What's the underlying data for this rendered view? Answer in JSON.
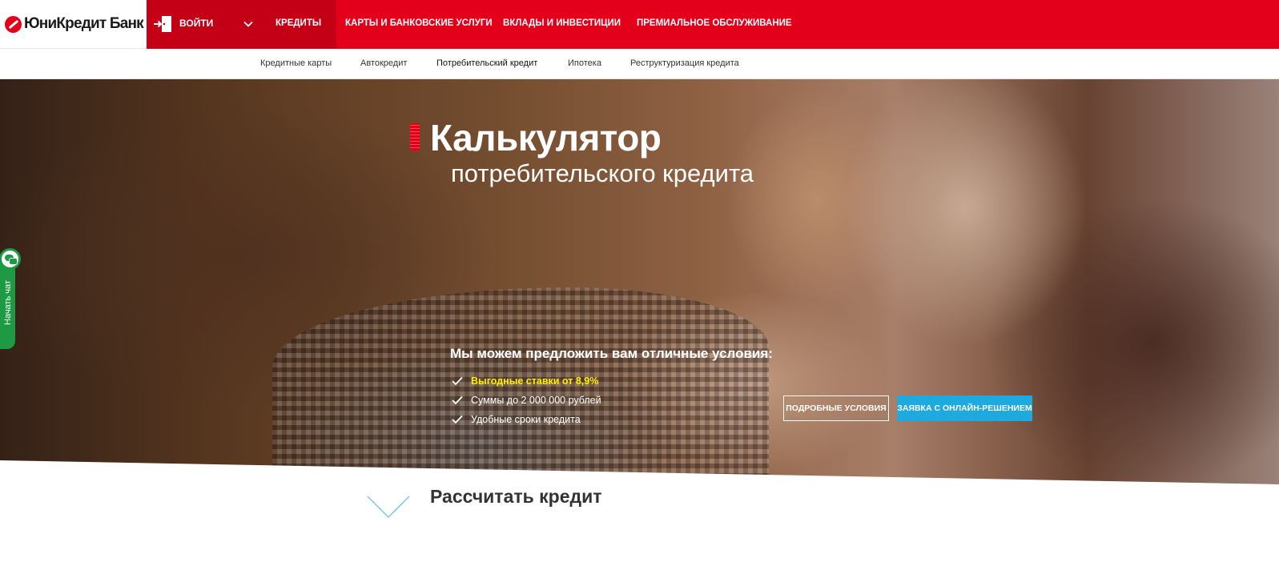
{
  "brand": {
    "logo_text": "ЮниКредит Банк",
    "primary_color": "#e2001a",
    "accent_color": "#1eaade",
    "chat_color": "#1d9a43"
  },
  "header": {
    "login_label": "ВОЙТИ",
    "nav": [
      {
        "label": "КРЕДИТЫ",
        "active": true
      },
      {
        "label": "КАРТЫ И БАНКОВСКИЕ УСЛУГИ"
      },
      {
        "label": "ВКЛАДЫ И ИНВЕСТИЦИИ"
      },
      {
        "label": "ПРЕМИАЛЬНОЕ ОБСЛУЖИВАНИЕ"
      }
    ]
  },
  "subnav": [
    {
      "label": "Кредитные карты"
    },
    {
      "label": "Автокредит"
    },
    {
      "label": "Потребительский кредит",
      "active": true
    },
    {
      "label": "Ипотека"
    },
    {
      "label": "Реструктуризация кредита"
    }
  ],
  "hero": {
    "title": "Калькулятор",
    "subtitle": "потребительского кредита",
    "offer_heading": "Мы можем предложить вам отличные условия:",
    "offers": [
      {
        "text": "Выгодные ставки от 8,9%",
        "highlight": true
      },
      {
        "text": "Суммы до 2 000 000 рублей"
      },
      {
        "text": "Удобные сроки кредита"
      }
    ],
    "details_button": "ПОДРОБНЫЕ УСЛОВИЯ",
    "apply_button": "ЗАЯВКА С ОНЛАЙН-РЕШЕНИЕМ"
  },
  "chat": {
    "label": "Начать чат"
  },
  "calculator": {
    "title": "Рассчитать кредит"
  }
}
